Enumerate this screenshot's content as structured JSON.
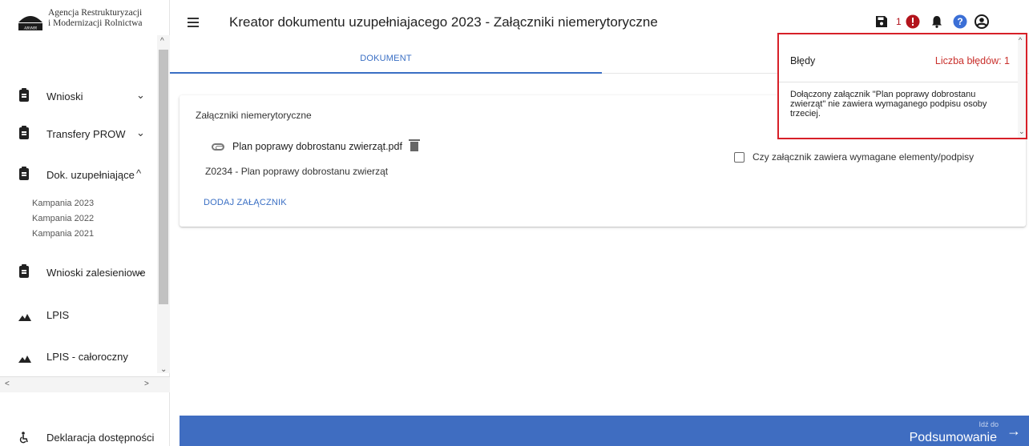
{
  "app": {
    "logo_line1": "Agencja Restrukturyzacji",
    "logo_line2": "i Modernizacji Rolnictwa",
    "logo_mark_text": "ARiMR"
  },
  "header": {
    "title": "Kreator dokumentu uzupełniajacego 2023 - Załączniki niemerytoryczne",
    "error_count": "1",
    "icons": [
      "save-icon",
      "error-icon",
      "bell-icon",
      "help-icon",
      "account-icon"
    ]
  },
  "sidebar": {
    "items": [
      {
        "label": "Wnioski",
        "icon": "clipboard-icon",
        "chevron": "⌄"
      },
      {
        "label": "Transfery PROW",
        "icon": "clipboard-icon",
        "chevron": "⌄"
      },
      {
        "label": "Dok. uzupełniające",
        "icon": "clipboard-icon",
        "chevron": "^"
      },
      {
        "label": "Wnioski zalesieniowe",
        "icon": "clipboard-icon",
        "chevron": "⌄"
      },
      {
        "label": "LPIS",
        "icon": "mountain-icon"
      },
      {
        "label": "LPIS - całoroczny",
        "icon": "mountain-icon"
      },
      {
        "label": "Deklaracja dostępności",
        "icon": "accessibility-icon"
      }
    ],
    "subitems": [
      "Kampania 2023",
      "Kampania 2022",
      "Kampania 2021"
    ]
  },
  "tabs": [
    {
      "label": "DOKUMENT",
      "active": true
    }
  ],
  "card": {
    "title": "Załączniki niemerytoryczne",
    "attachment_name": "Plan poprawy dobrostanu zwierząt.pdf",
    "attachment_code": "Z0234 - Plan poprawy dobrostanu zwierząt",
    "add_label": "DODAJ ZAŁĄCZNIK",
    "checkbox_label": "Czy załącznik zawiera wymagane elementy/podpisy",
    "checkbox_checked": false
  },
  "errors": {
    "title": "Błędy",
    "count_label": "Liczba błędów: 1",
    "message": "Dołączony załącznik \"Plan poprawy dobrostanu zwierząt\" nie zawiera wymaganego podpisu osoby trzeciej."
  },
  "footer": {
    "next_small": "Idź do",
    "next_label": "Podsumowanie",
    "next_arrow": "→"
  },
  "colors": {
    "accent": "#3a6fc4",
    "footer": "#3f6dc1",
    "error_red": "#d72028",
    "error_badge": "#b3141c",
    "help_blue": "#3b6fd6"
  }
}
